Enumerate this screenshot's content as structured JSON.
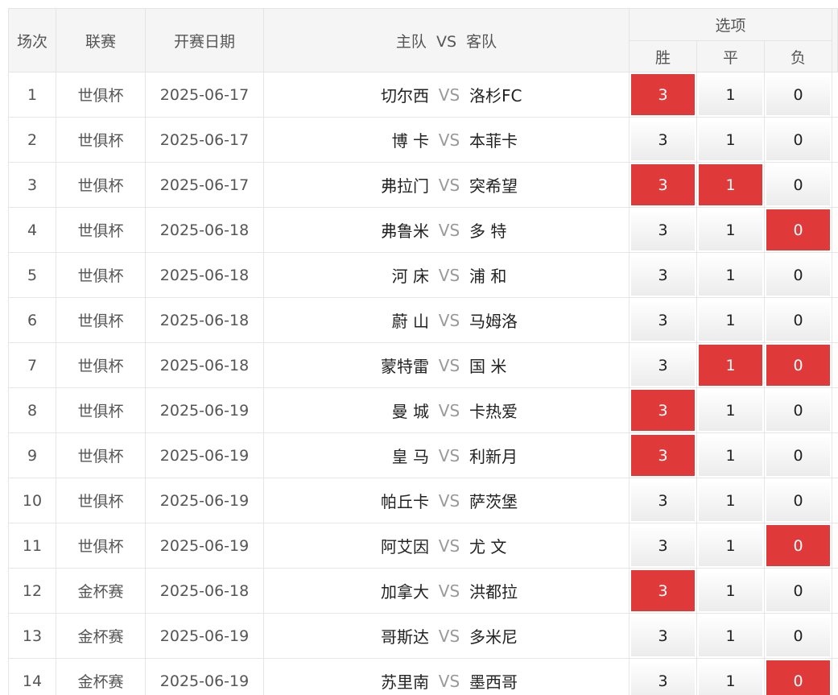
{
  "header": {
    "idx": "场次",
    "league": "联赛",
    "date": "开赛日期",
    "match_home": "主队",
    "match_vs": "VS",
    "match_away": "客队",
    "options": "选项",
    "win": "胜",
    "draw": "平",
    "lose": "负"
  },
  "vs_label": "VS",
  "colors": {
    "selected": "#e0393a",
    "header_bg": "#f5f5f5"
  },
  "rows": [
    {
      "idx": "1",
      "league": "世俱杯",
      "date": "2025-06-17",
      "home": "切尔西",
      "away": "洛杉FC",
      "opts": [
        {
          "label": "3",
          "sel": true
        },
        {
          "label": "1",
          "sel": false
        },
        {
          "label": "0",
          "sel": false
        }
      ]
    },
    {
      "idx": "2",
      "league": "世俱杯",
      "date": "2025-06-17",
      "home": "博 卡",
      "away": "本菲卡",
      "opts": [
        {
          "label": "3",
          "sel": false
        },
        {
          "label": "1",
          "sel": false
        },
        {
          "label": "0",
          "sel": false
        }
      ]
    },
    {
      "idx": "3",
      "league": "世俱杯",
      "date": "2025-06-17",
      "home": "弗拉门",
      "away": "突希望",
      "opts": [
        {
          "label": "3",
          "sel": true
        },
        {
          "label": "1",
          "sel": true
        },
        {
          "label": "0",
          "sel": false
        }
      ]
    },
    {
      "idx": "4",
      "league": "世俱杯",
      "date": "2025-06-18",
      "home": "弗鲁米",
      "away": "多 特",
      "opts": [
        {
          "label": "3",
          "sel": false
        },
        {
          "label": "1",
          "sel": false
        },
        {
          "label": "0",
          "sel": true
        }
      ]
    },
    {
      "idx": "5",
      "league": "世俱杯",
      "date": "2025-06-18",
      "home": "河 床",
      "away": "浦 和",
      "opts": [
        {
          "label": "3",
          "sel": false
        },
        {
          "label": "1",
          "sel": false
        },
        {
          "label": "0",
          "sel": false
        }
      ]
    },
    {
      "idx": "6",
      "league": "世俱杯",
      "date": "2025-06-18",
      "home": "蔚 山",
      "away": "马姆洛",
      "opts": [
        {
          "label": "3",
          "sel": false
        },
        {
          "label": "1",
          "sel": false
        },
        {
          "label": "0",
          "sel": false
        }
      ]
    },
    {
      "idx": "7",
      "league": "世俱杯",
      "date": "2025-06-18",
      "home": "蒙特雷",
      "away": "国 米",
      "opts": [
        {
          "label": "3",
          "sel": false
        },
        {
          "label": "1",
          "sel": true
        },
        {
          "label": "0",
          "sel": true
        }
      ]
    },
    {
      "idx": "8",
      "league": "世俱杯",
      "date": "2025-06-19",
      "home": "曼 城",
      "away": "卡热爱",
      "opts": [
        {
          "label": "3",
          "sel": true
        },
        {
          "label": "1",
          "sel": false
        },
        {
          "label": "0",
          "sel": false
        }
      ]
    },
    {
      "idx": "9",
      "league": "世俱杯",
      "date": "2025-06-19",
      "home": "皇 马",
      "away": "利新月",
      "opts": [
        {
          "label": "3",
          "sel": true
        },
        {
          "label": "1",
          "sel": false
        },
        {
          "label": "0",
          "sel": false
        }
      ]
    },
    {
      "idx": "10",
      "league": "世俱杯",
      "date": "2025-06-19",
      "home": "帕丘卡",
      "away": "萨茨堡",
      "opts": [
        {
          "label": "3",
          "sel": false
        },
        {
          "label": "1",
          "sel": false
        },
        {
          "label": "0",
          "sel": false
        }
      ]
    },
    {
      "idx": "11",
      "league": "世俱杯",
      "date": "2025-06-19",
      "home": "阿艾因",
      "away": "尤 文",
      "opts": [
        {
          "label": "3",
          "sel": false
        },
        {
          "label": "1",
          "sel": false
        },
        {
          "label": "0",
          "sel": true
        }
      ]
    },
    {
      "idx": "12",
      "league": "金杯赛",
      "date": "2025-06-18",
      "home": "加拿大",
      "away": "洪都拉",
      "opts": [
        {
          "label": "3",
          "sel": true
        },
        {
          "label": "1",
          "sel": false
        },
        {
          "label": "0",
          "sel": false
        }
      ]
    },
    {
      "idx": "13",
      "league": "金杯赛",
      "date": "2025-06-19",
      "home": "哥斯达",
      "away": "多米尼",
      "opts": [
        {
          "label": "3",
          "sel": false
        },
        {
          "label": "1",
          "sel": false
        },
        {
          "label": "0",
          "sel": false
        }
      ]
    },
    {
      "idx": "14",
      "league": "金杯赛",
      "date": "2025-06-19",
      "home": "苏里南",
      "away": "墨西哥",
      "opts": [
        {
          "label": "3",
          "sel": false
        },
        {
          "label": "1",
          "sel": false
        },
        {
          "label": "0",
          "sel": true
        }
      ]
    }
  ]
}
